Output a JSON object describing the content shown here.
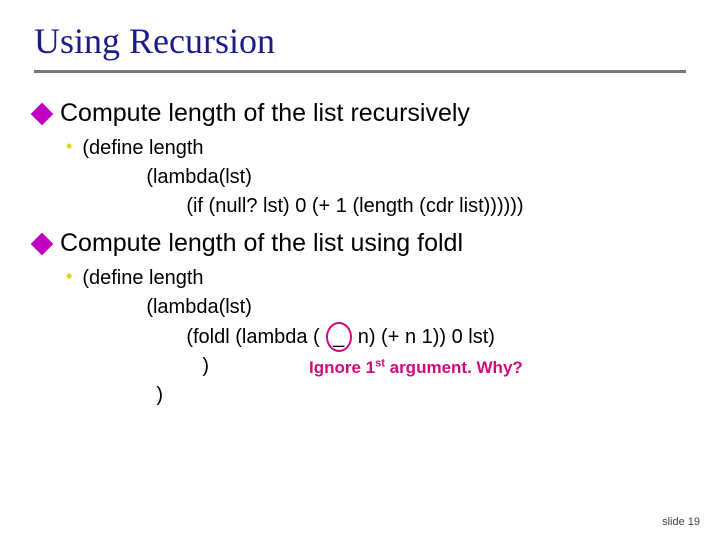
{
  "title": "Using Recursion",
  "point1": "Compute length of the list recursively",
  "code1": {
    "l1": "(define length",
    "l2": "(lambda(lst)",
    "l3": "(if (null? lst) 0 (+ 1 (length (cdr list))))))"
  },
  "point2": "Compute length of the list using foldl",
  "code2": {
    "l1": "(define length",
    "l2": "(lambda(lst)",
    "l3a": "(foldl (lambda (",
    "l3_underscore": "_",
    "l3b": "n) (+ n 1)) 0 lst)",
    "l4": ")",
    "l5": ")"
  },
  "ignore": {
    "pre": "Ignore 1",
    "sup": "st",
    "post": " argument.  Why?"
  },
  "footer": "slide 19"
}
